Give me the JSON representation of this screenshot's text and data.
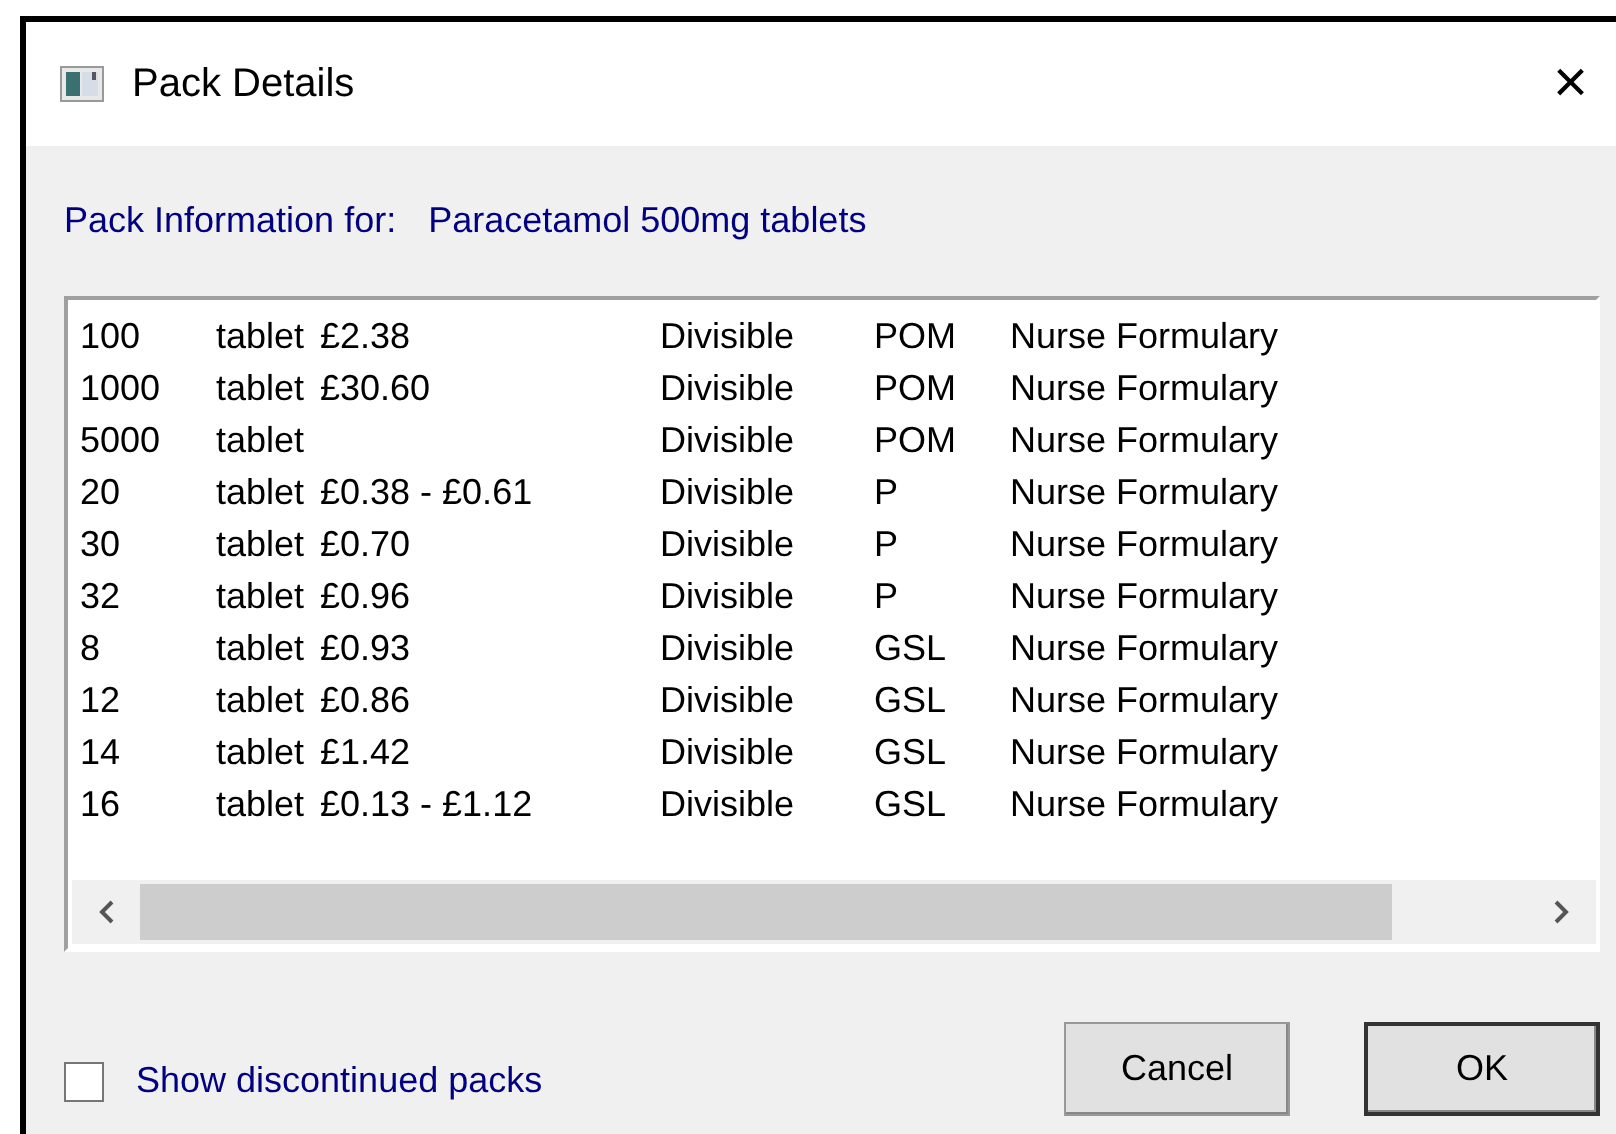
{
  "window": {
    "title": "Pack Details",
    "close": "×"
  },
  "header": {
    "label": "Pack Information for:",
    "product": "Paracetamol 500mg tablets"
  },
  "packs": [
    {
      "size": "100",
      "unit": "tablet",
      "price": "£2.38",
      "divisibility": "Divisible",
      "category": "POM",
      "formulary": "Nurse Formulary"
    },
    {
      "size": "1000",
      "unit": "tablet",
      "price": "£30.60",
      "divisibility": "Divisible",
      "category": "POM",
      "formulary": "Nurse Formulary"
    },
    {
      "size": "5000",
      "unit": "tablet",
      "divisibility": "Divisible",
      "category": "POM",
      "formulary": "Nurse Formulary"
    },
    {
      "size": "20",
      "unit": "tablet",
      "price": "£0.38 - £0.61",
      "divisibility": "Divisible",
      "category": "P",
      "formulary": "Nurse Formulary"
    },
    {
      "size": "30",
      "unit": "tablet",
      "price": "£0.70",
      "divisibility": "Divisible",
      "category": "P",
      "formulary": "Nurse Formulary"
    },
    {
      "size": "32",
      "unit": "tablet",
      "price": "£0.96",
      "divisibility": "Divisible",
      "category": "P",
      "formulary": "Nurse Formulary"
    },
    {
      "size": "8",
      "unit": "tablet",
      "price": "£0.93",
      "divisibility": "Divisible",
      "category": "GSL",
      "formulary": "Nurse Formulary"
    },
    {
      "size": "12",
      "unit": "tablet",
      "price": "£0.86",
      "divisibility": "Divisible",
      "category": "GSL",
      "formulary": "Nurse Formulary"
    },
    {
      "size": "14",
      "unit": "tablet",
      "price": "£1.42",
      "divisibility": "Divisible",
      "category": "GSL",
      "formulary": "Nurse Formulary"
    },
    {
      "size": "16",
      "unit": "tablet",
      "price": "£0.13 - £1.12",
      "divisibility": "Divisible",
      "category": "GSL",
      "formulary": "Nurse Formulary"
    }
  ],
  "show_discontinued": {
    "label": "Show discontinued packs",
    "checked": false
  },
  "buttons": [
    {
      "label": "Cancel",
      "default": false
    },
    {
      "label": "OK",
      "default": true
    }
  ]
}
